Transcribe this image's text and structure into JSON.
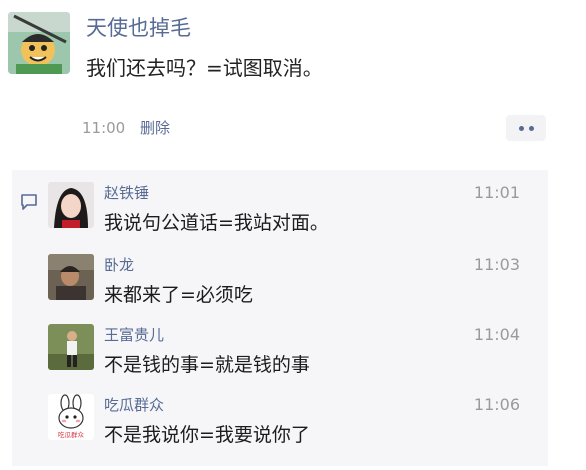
{
  "post": {
    "author": "天使也掉毛",
    "text": "我们还去吗？=试图取消。",
    "time": "11:00",
    "delete_label": "删除",
    "more_icon": "more-dots-icon"
  },
  "comments": [
    {
      "name": "赵铁锤",
      "text": "我说句公道话=我站对面。",
      "time": "11:01"
    },
    {
      "name": "卧龙",
      "text": "来都来了=必须吃",
      "time": "11:03"
    },
    {
      "name": "王富贵儿",
      "text": "不是钱的事=就是钱的事",
      "time": "11:04"
    },
    {
      "name": "吃瓜群众",
      "text": "不是我说你=我要说你了",
      "time": "11:06",
      "avatar_caption": "吃瓜群众"
    }
  ],
  "colors": {
    "name_link": "#576b95",
    "meta_gray": "#9a9a9a",
    "panel_bg": "#f6f6f8"
  }
}
